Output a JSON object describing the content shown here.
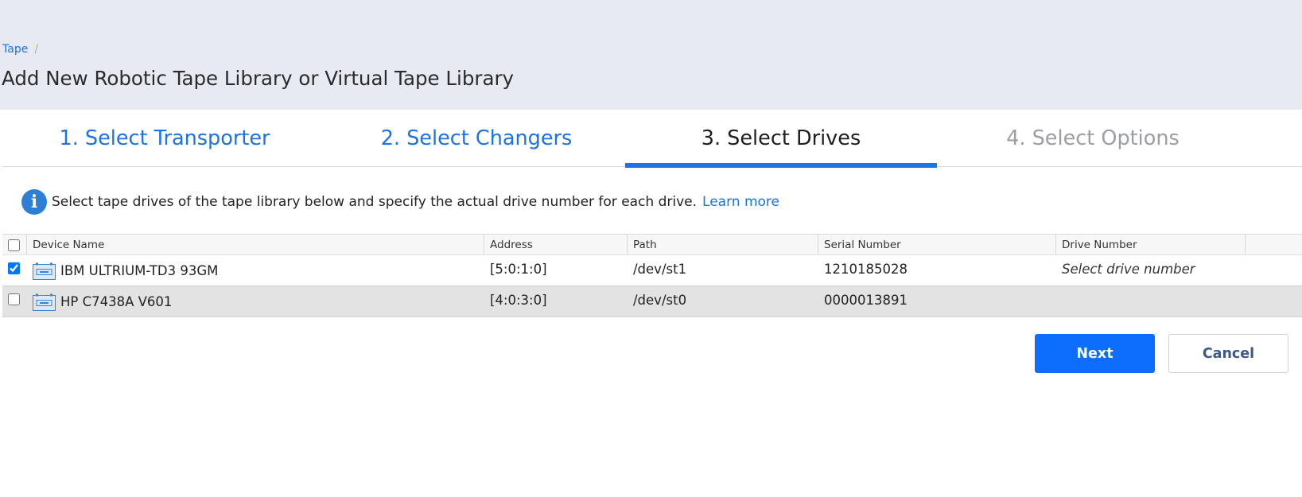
{
  "breadcrumb": {
    "root": "Tape",
    "separator": "/"
  },
  "page_title": "Add New Robotic Tape Library or Virtual Tape Library",
  "wizard": {
    "steps": [
      {
        "label": "1. Select Transporter",
        "state": "done"
      },
      {
        "label": "2. Select Changers",
        "state": "done"
      },
      {
        "label": "3. Select Drives",
        "state": "active"
      },
      {
        "label": "4. Select Options",
        "state": "future"
      }
    ]
  },
  "info": {
    "icon": "info-icon",
    "text": "Select tape drives of the tape library below and specify the actual drive number for each drive.",
    "link": "Learn more"
  },
  "table": {
    "columns": [
      "Device Name",
      "Address",
      "Path",
      "Serial Number",
      "Drive Number"
    ],
    "rows": [
      {
        "checked": true,
        "device": "IBM ULTRIUM-TD3 93GM",
        "address": "[5:0:1:0]",
        "path": "/dev/st1",
        "serial": "1210185028",
        "drive_number": "Select drive number"
      },
      {
        "checked": false,
        "device": "HP C7438A V601",
        "address": "[4:0:3:0]",
        "path": "/dev/st0",
        "serial": "0000013891",
        "drive_number": ""
      }
    ]
  },
  "buttons": {
    "next": "Next",
    "cancel": "Cancel"
  },
  "colors": {
    "accent": "#1a73e8",
    "primary_button": "#0d6efd",
    "header_bg": "#e7eaf2",
    "alt_row": "#e3e3e3"
  }
}
